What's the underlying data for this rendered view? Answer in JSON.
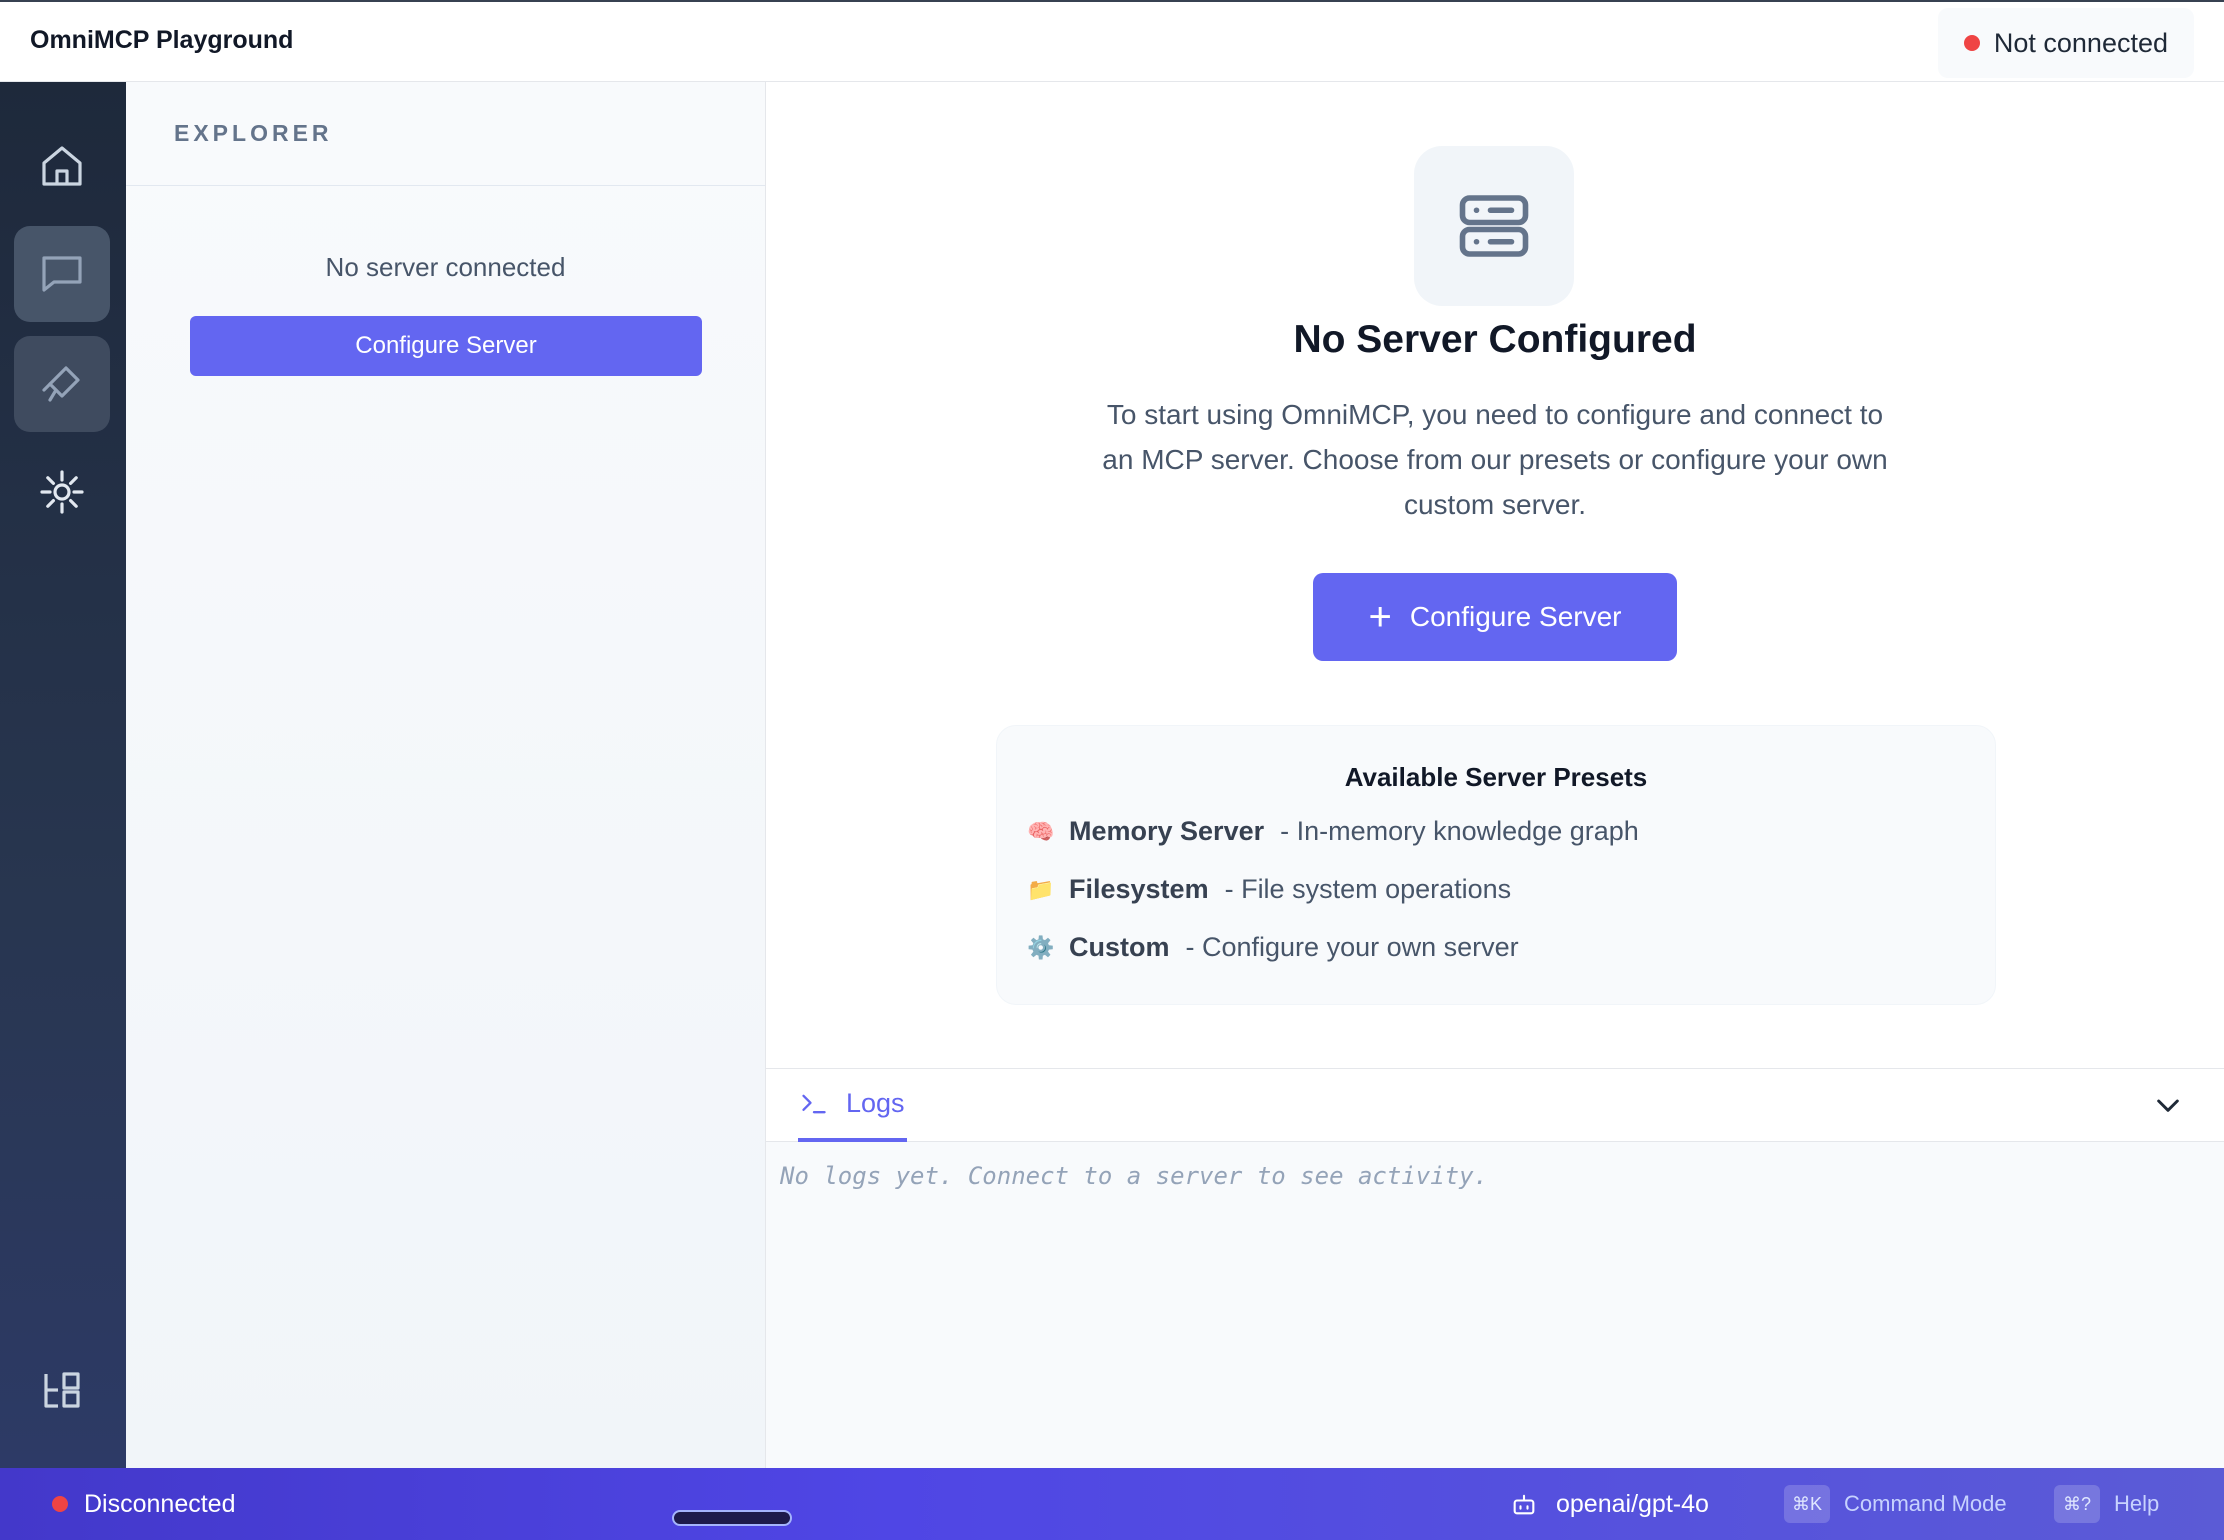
{
  "app": {
    "title": "OmniMCP Playground"
  },
  "connection": {
    "label": "Not connected",
    "status_color": "#ef4444"
  },
  "rail": {
    "items": [
      {
        "name": "home",
        "icon": "home-icon"
      },
      {
        "name": "chat",
        "icon": "chat-icon"
      },
      {
        "name": "tools",
        "icon": "tools-icon"
      },
      {
        "name": "debug",
        "icon": "bug-icon"
      },
      {
        "name": "widgets",
        "icon": "widgets-icon"
      }
    ]
  },
  "explorer": {
    "title": "EXPLORER",
    "empty_text": "No server connected",
    "configure_label": "Configure Server"
  },
  "main": {
    "icon": "server-icon",
    "title": "No Server Configured",
    "description": "To start using OmniMCP, you need to configure and connect to an MCP server. Choose from our presets or configure your own custom server.",
    "configure_label": "Configure Server",
    "presets": {
      "title": "Available Server Presets",
      "items": [
        {
          "emoji": "🧠",
          "name": "Memory Server",
          "desc": "- In-memory knowledge graph"
        },
        {
          "emoji": "📁",
          "name": "Filesystem",
          "desc": "- File system operations"
        },
        {
          "emoji": "⚙️",
          "name": "Custom",
          "desc": "- Configure your own server"
        }
      ]
    }
  },
  "logs": {
    "tab_label": "Logs",
    "empty_text": "No logs yet. Connect to a server to see activity."
  },
  "statusbar": {
    "connection": "Disconnected",
    "model": "openai/gpt-4o",
    "command_key": "⌘K",
    "command_label": "Command Mode",
    "help_key": "⌘?",
    "help_label": "Help"
  },
  "colors": {
    "accent": "#6366f1",
    "rail_bg": "#1e293b",
    "status_bar": "#4f46e5"
  }
}
